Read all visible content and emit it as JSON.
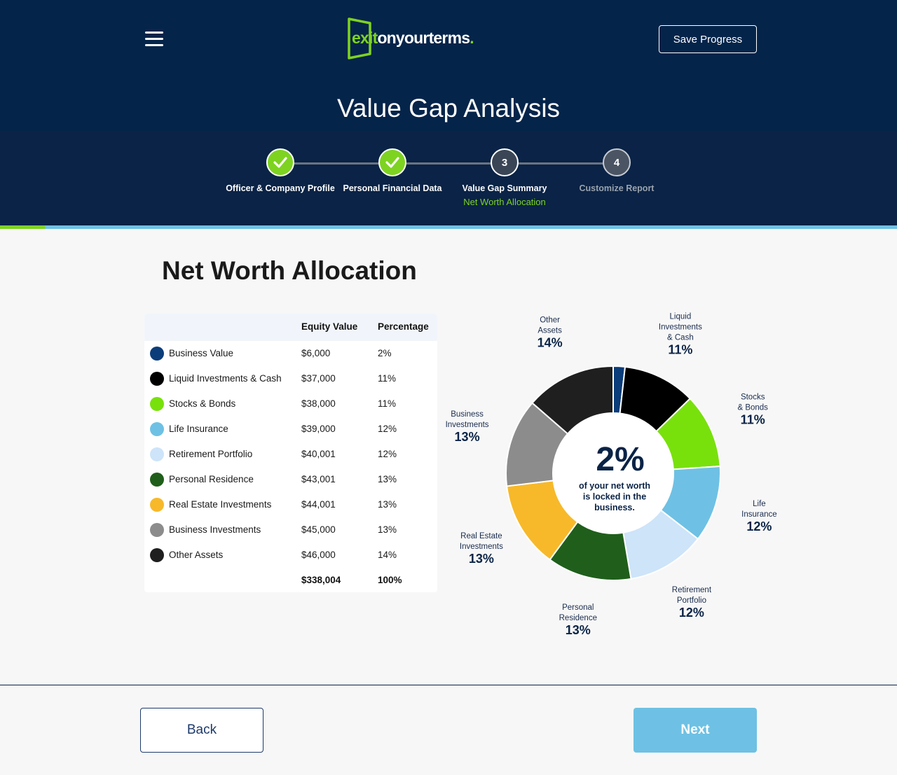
{
  "header": {
    "logo_part1": "exit",
    "logo_part2": "onyourterms",
    "logo_dot": ".",
    "save_label": "Save Progress",
    "title": "Value Gap Analysis"
  },
  "stepper": {
    "steps": [
      {
        "label": "Officer & Company Profile",
        "state": "done",
        "number": ""
      },
      {
        "label": "Personal Financial Data",
        "state": "done",
        "number": ""
      },
      {
        "label": "Value Gap Summary",
        "state": "active",
        "number": "3",
        "sublabel": "Net Worth Allocation"
      },
      {
        "label": "Customize Report",
        "state": "future",
        "number": "4"
      }
    ],
    "progress": 0.05
  },
  "section_title": "Net Worth Allocation",
  "table": {
    "headers": {
      "value": "Equity Value",
      "percent": "Percentage"
    },
    "rows": [
      {
        "label": "Business Value",
        "value": "$6,000",
        "percent": "2%",
        "color": "#0b3d7a"
      },
      {
        "label": "Liquid Investments & Cash",
        "value": "$37,000",
        "percent": "11%",
        "color": "#000000"
      },
      {
        "label": "Stocks & Bonds",
        "value": "$38,000",
        "percent": "11%",
        "color": "#78e10c"
      },
      {
        "label": "Life Insurance",
        "value": "$39,000",
        "percent": "12%",
        "color": "#6ec1e4"
      },
      {
        "label": "Retirement Portfolio",
        "value": "$40,001",
        "percent": "12%",
        "color": "#cde4f9"
      },
      {
        "label": "Personal Residence",
        "value": "$43,001",
        "percent": "13%",
        "color": "#1f5f1b"
      },
      {
        "label": "Real Estate Investments",
        "value": "$44,001",
        "percent": "13%",
        "color": "#f7b92a"
      },
      {
        "label": "Business Investments",
        "value": "$45,000",
        "percent": "13%",
        "color": "#8c8c8c"
      },
      {
        "label": "Other Assets",
        "value": "$46,000",
        "percent": "14%",
        "color": "#1f1f1f"
      }
    ],
    "total": {
      "value": "$338,004",
      "percent": "100%"
    }
  },
  "chart_data": {
    "type": "pie",
    "center_value": "2%",
    "center_text": [
      "of your net worth",
      "is locked in the",
      "business."
    ],
    "series": [
      {
        "name": "Business Value",
        "value": 6000,
        "label_lines": [],
        "percent_label": "",
        "color": "#0b3d7a"
      },
      {
        "name": "Liquid Investments & Cash",
        "value": 37000,
        "label_lines": [
          "Liquid",
          "Investments",
          "& Cash"
        ],
        "percent_label": "11%",
        "color": "#000000"
      },
      {
        "name": "Stocks & Bonds",
        "value": 38000,
        "label_lines": [
          "Stocks",
          "& Bonds"
        ],
        "percent_label": "11%",
        "color": "#78e10c"
      },
      {
        "name": "Life Insurance",
        "value": 39000,
        "label_lines": [
          "Life",
          "Insurance"
        ],
        "percent_label": "12%",
        "color": "#6ec1e4"
      },
      {
        "name": "Retirement Portfolio",
        "value": 40001,
        "label_lines": [
          "Retirement",
          "Portfolio"
        ],
        "percent_label": "12%",
        "color": "#cde4f9"
      },
      {
        "name": "Personal Residence",
        "value": 43001,
        "label_lines": [
          "Personal",
          "Residence"
        ],
        "percent_label": "13%",
        "color": "#1f5f1b"
      },
      {
        "name": "Real Estate Investments",
        "value": 44001,
        "label_lines": [
          "Real Estate",
          "Investments"
        ],
        "percent_label": "13%",
        "color": "#f7b92a"
      },
      {
        "name": "Business Investments",
        "value": 45000,
        "label_lines": [
          "Business",
          "Investments"
        ],
        "percent_label": "13%",
        "color": "#8c8c8c"
      },
      {
        "name": "Other Assets",
        "value": 46000,
        "label_lines": [
          "Other",
          "Assets"
        ],
        "percent_label": "14%",
        "color": "#1f1f1f"
      }
    ]
  },
  "footer": {
    "back_label": "Back",
    "next_label": "Next"
  }
}
